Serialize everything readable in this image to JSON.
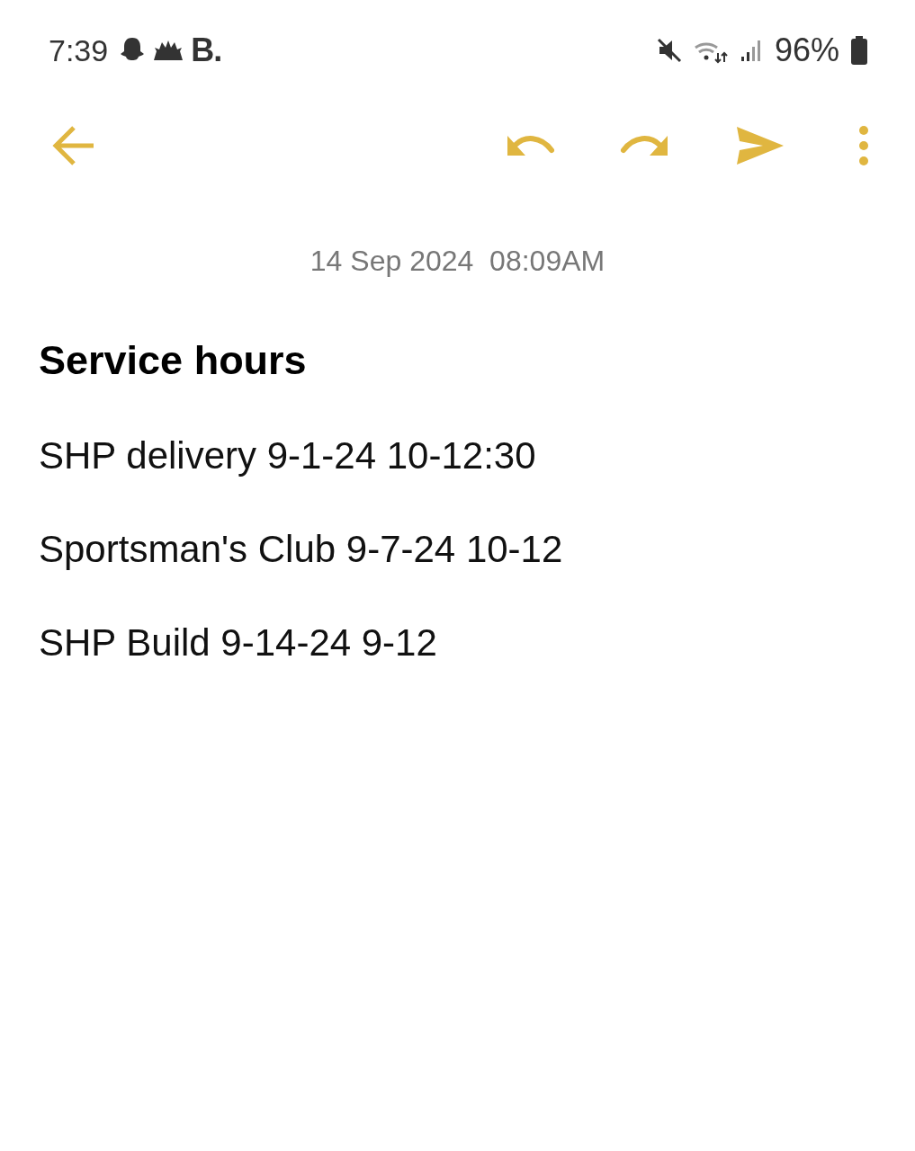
{
  "status_bar": {
    "time": "7:39",
    "app_letter": "B.",
    "battery": "96%"
  },
  "note": {
    "date": "14 Sep 2024  08:09AM",
    "title": "Service hours",
    "lines": [
      "SHP delivery 9-1-24 10-12:30",
      "Sportsman's Club 9-7-24 10-12",
      "SHP Build 9-14-24 9-12"
    ]
  }
}
